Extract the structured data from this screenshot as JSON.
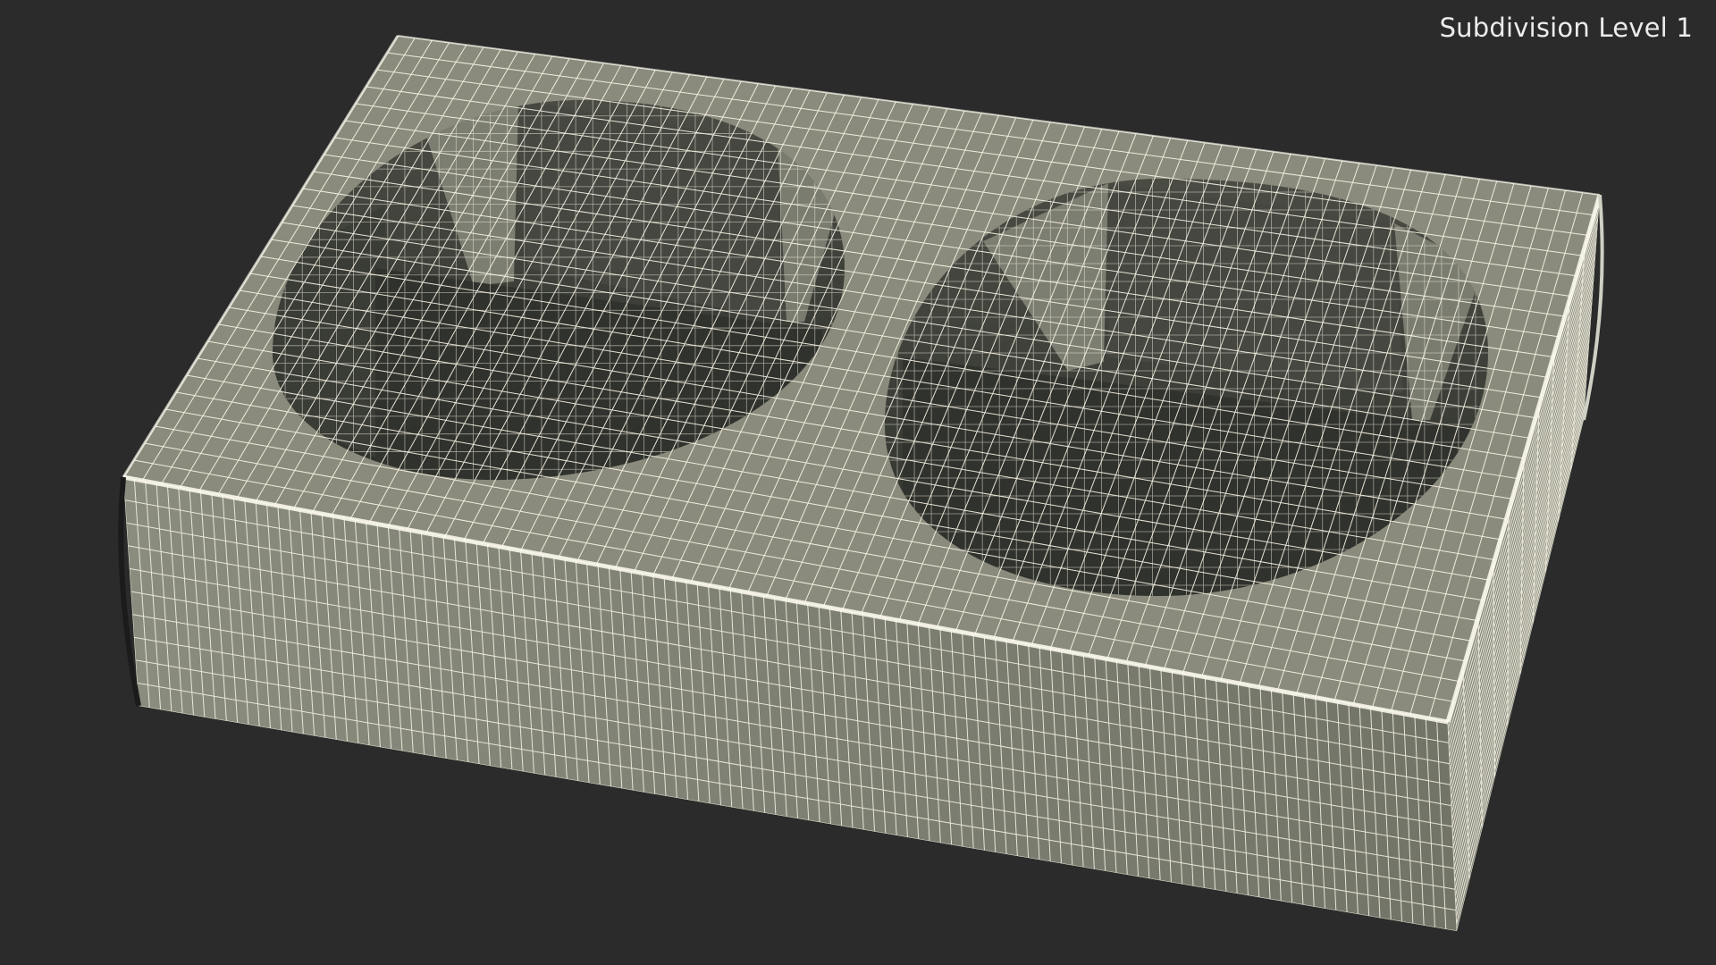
{
  "viewport": {
    "overlay_label": "Subdivision Level 1",
    "background_color": "#2b2b2b",
    "model": {
      "subject": "double cup holder",
      "render_mode": "wireframe on shaded",
      "colors": {
        "top_face": "#8a8b7c",
        "front_face": "#7b7d70",
        "side_face": "#85877a",
        "interior_wall": "#3f413a",
        "interior_floor": "#33352f",
        "wire": "#fbf7e8",
        "edge_highlight": "#ffffff"
      }
    }
  }
}
